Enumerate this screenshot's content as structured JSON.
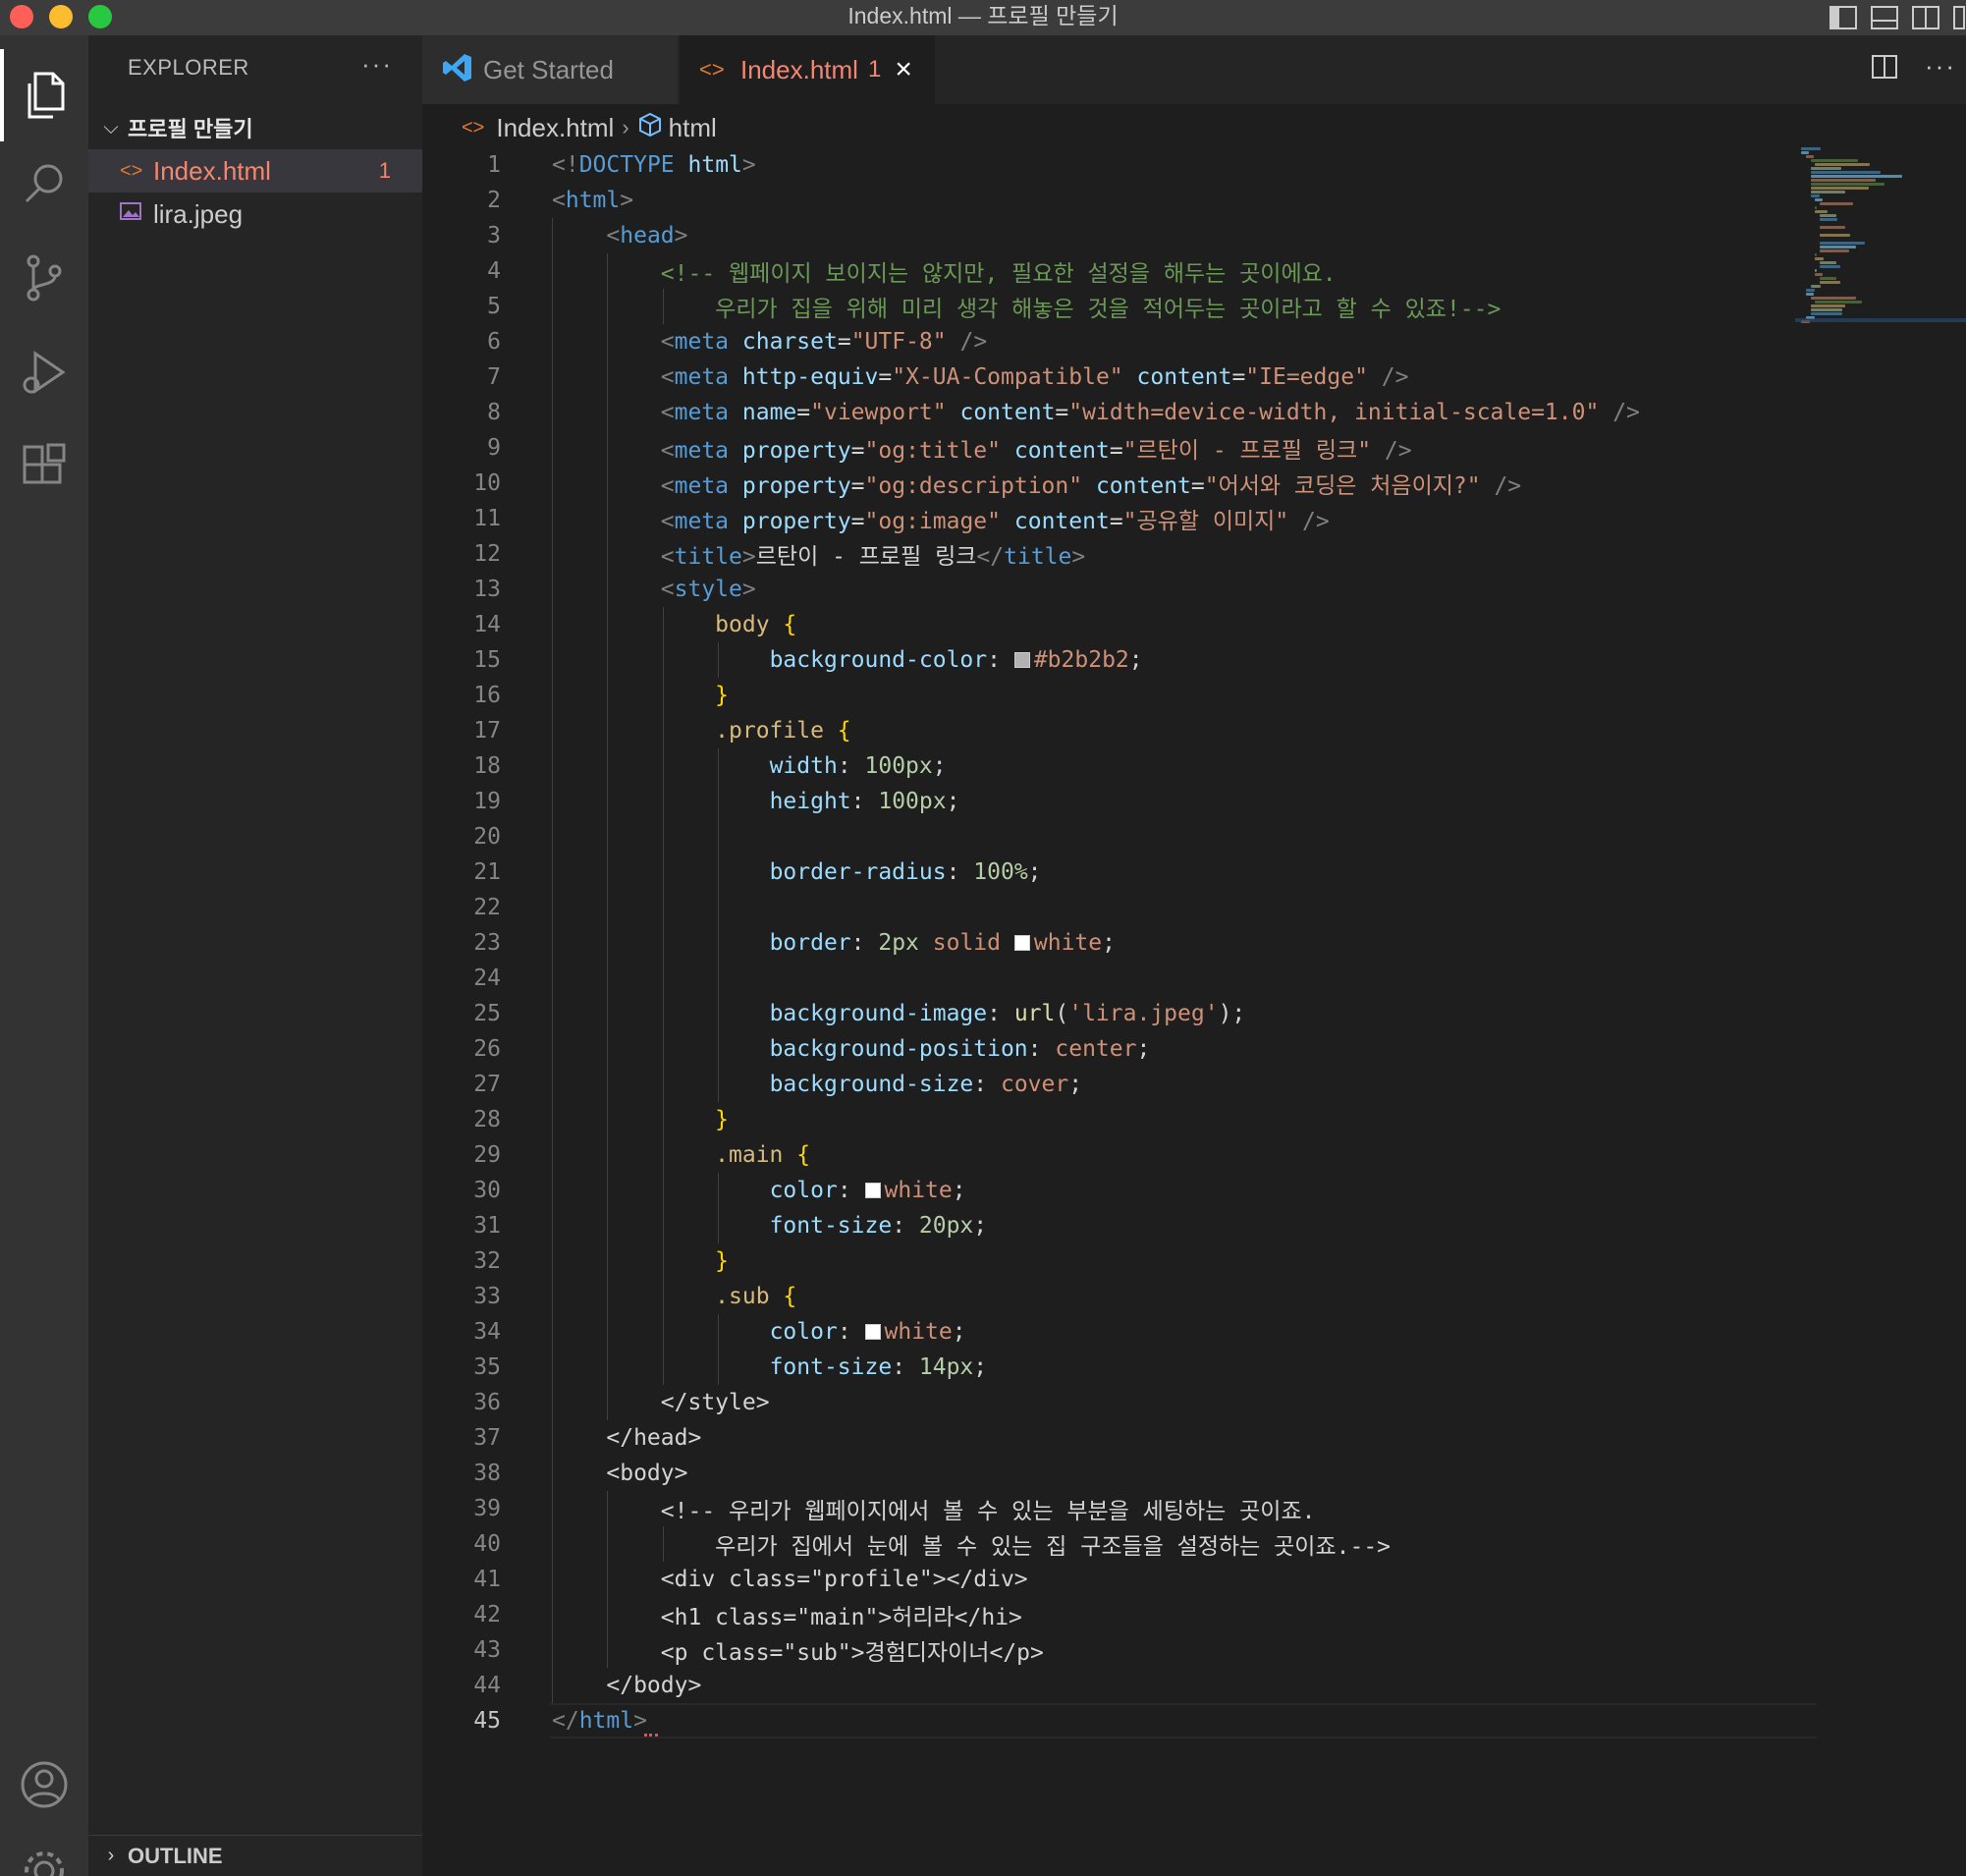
{
  "window": {
    "title": "Index.html — 프로필 만들기"
  },
  "colors": {
    "tag": "#569cd6",
    "attribute": "#9cdcfe",
    "string": "#ce9178",
    "comment": "#6a9955",
    "selector": "#d7ba7d",
    "brace": "#ffd700",
    "number": "#b5cea8",
    "error": "#f48771",
    "swatch_grey": "#b2b2b2",
    "swatch_white": "#ffffff"
  },
  "activity_bar": {
    "icons": [
      "explorer-icon",
      "search-icon",
      "source-control-icon",
      "run-debug-icon",
      "extensions-icon",
      "account-icon",
      "manage-gear-icon"
    ]
  },
  "sidebar": {
    "header": "EXPLORER",
    "more": "···",
    "folder": {
      "chevron": "⌵",
      "label": "프로필 만들기"
    },
    "files": [
      {
        "name": "Index.html",
        "icon": "<>",
        "badge": "1"
      },
      {
        "name": "lira.jpeg",
        "icon": "image-icon"
      }
    ],
    "outline": {
      "chevron": "›",
      "label": "OUTLINE"
    }
  },
  "tabs": [
    {
      "label": "Get Started"
    },
    {
      "label": "Index.html",
      "badge": "1",
      "close": "×"
    }
  ],
  "tab_actions": {
    "more": "···"
  },
  "breadcrumb": {
    "file": "Index.html",
    "sep": "›",
    "symbol": "html"
  },
  "editor": {
    "current_line": 45,
    "lines": [
      {
        "n": "1",
        "t": "<!DOCTYPE html>"
      },
      {
        "n": "2",
        "t": "<html>"
      },
      {
        "n": "3",
        "t": "    <head>"
      },
      {
        "n": "4",
        "t": "        <!-- 웹페이지 보이지는 않지만, 필요한 설정을 해두는 곳이에요."
      },
      {
        "n": "5",
        "t": "            우리가 집을 위해 미리 생각 해놓은 것을 적어두는 곳이라고 할 수 있죠!-->"
      },
      {
        "n": "6",
        "t": "        <meta charset=\"UTF-8\" />"
      },
      {
        "n": "7",
        "t": "        <meta http-equiv=\"X-UA-Compatible\" content=\"IE=edge\" />"
      },
      {
        "n": "8",
        "t": "        <meta name=\"viewport\" content=\"width=device-width, initial-scale=1.0\" />"
      },
      {
        "n": "9",
        "t": "        <meta property=\"og:title\" content=\"르탄이 - 프로필 링크\" />"
      },
      {
        "n": "10",
        "t": "        <meta property=\"og:description\" content=\"어서와 코딩은 처음이지?\" />"
      },
      {
        "n": "11",
        "t": "        <meta property=\"og:image\" content=\"공유할 이미지\" />"
      },
      {
        "n": "12",
        "t": "        <title>르탄이 - 프로필 링크</title>"
      },
      {
        "n": "13",
        "t": "        <style>"
      },
      {
        "n": "14",
        "t": "            body {"
      },
      {
        "n": "15",
        "t": "                background-color: #b2b2b2;"
      },
      {
        "n": "16",
        "t": "            }"
      },
      {
        "n": "17",
        "t": "            .profile {"
      },
      {
        "n": "18",
        "t": "                width: 100px;"
      },
      {
        "n": "19",
        "t": "                height: 100px;"
      },
      {
        "n": "20",
        "t": ""
      },
      {
        "n": "21",
        "t": "                border-radius: 100%;"
      },
      {
        "n": "22",
        "t": ""
      },
      {
        "n": "23",
        "t": "                border: 2px solid white;"
      },
      {
        "n": "24",
        "t": ""
      },
      {
        "n": "25",
        "t": "                background-image: url('lira.jpeg');"
      },
      {
        "n": "26",
        "t": "                background-position: center;"
      },
      {
        "n": "27",
        "t": "                background-size: cover;"
      },
      {
        "n": "28",
        "t": "            }"
      },
      {
        "n": "29",
        "t": "            .main {"
      },
      {
        "n": "30",
        "t": "                color: white;"
      },
      {
        "n": "31",
        "t": "                font-size: 20px;"
      },
      {
        "n": "32",
        "t": "            }"
      },
      {
        "n": "33",
        "t": "            .sub {"
      },
      {
        "n": "34",
        "t": "                color: white;"
      },
      {
        "n": "35",
        "t": "                font-size: 14px;"
      },
      {
        "n": "36",
        "t": "        </style>"
      },
      {
        "n": "37",
        "t": "    </head>"
      },
      {
        "n": "38",
        "t": "    <body>"
      },
      {
        "n": "39",
        "t": "        <!-- 우리가 웹페이지에서 볼 수 있는 부분을 세팅하는 곳이죠."
      },
      {
        "n": "40",
        "t": "            우리가 집에서 눈에 볼 수 있는 집 구조들을 설정하는 곳이죠.-->"
      },
      {
        "n": "41",
        "t": "        <div class=\"profile\"></div>"
      },
      {
        "n": "42",
        "t": "        <h1 class=\"main\">허리라</hi>"
      },
      {
        "n": "43",
        "t": "        <p class=\"sub\">경험디자이너</p>"
      },
      {
        "n": "44",
        "t": "    </body>"
      },
      {
        "n": "45",
        "t": "</html>"
      }
    ]
  }
}
